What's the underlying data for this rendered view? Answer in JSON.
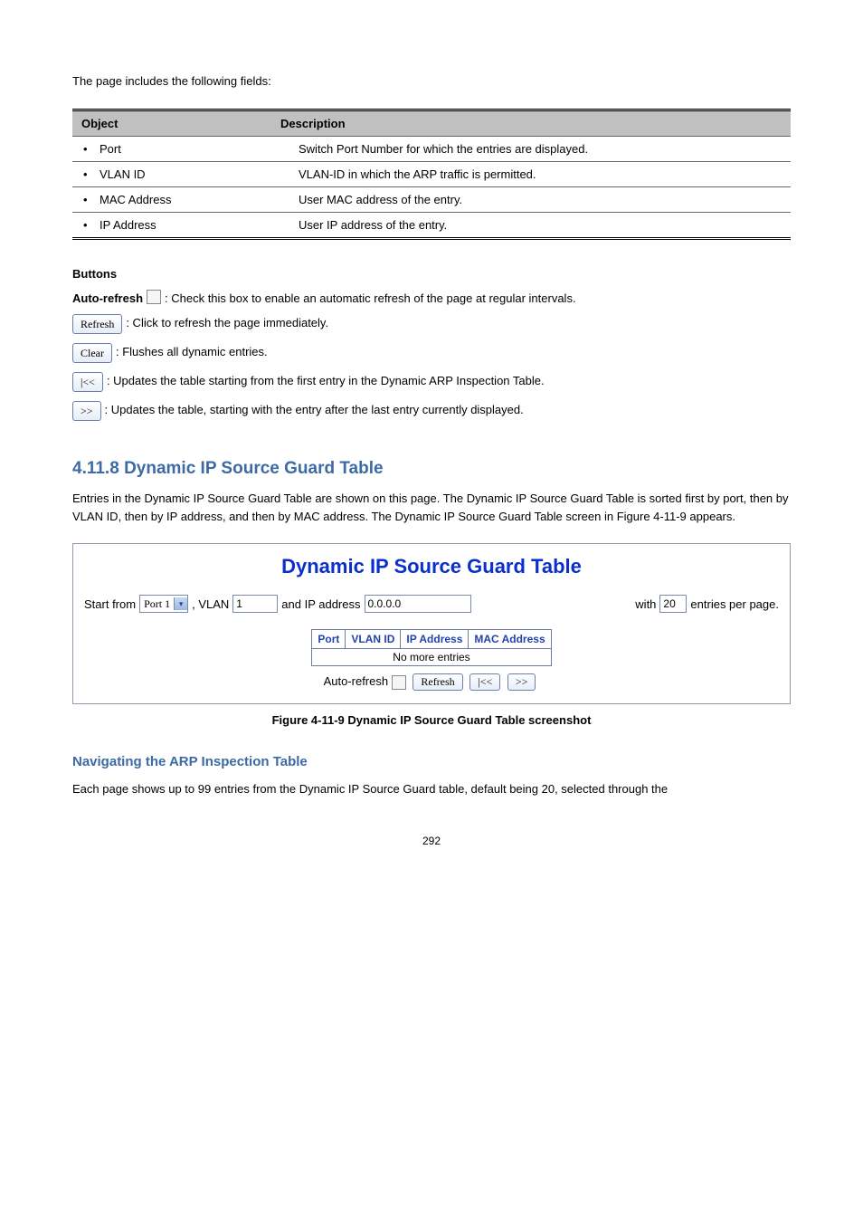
{
  "intro": "The page includes the following fields:",
  "table_headers": {
    "object": "Object",
    "description": "Description"
  },
  "rows": [
    {
      "obj": "Port",
      "desc": "Switch Port Number for which the entries are displayed."
    },
    {
      "obj": "VLAN ID",
      "desc": "VLAN-ID in which the ARP traffic is permitted."
    },
    {
      "obj": "MAC Address",
      "desc": "User MAC address of the entry."
    },
    {
      "obj": "IP Address",
      "desc": "User IP address of the entry."
    }
  ],
  "buttons_heading": "Buttons",
  "controls": {
    "auto_refresh_label": "Auto-refresh",
    "auto_refresh_desc": ": Check this box to enable an automatic refresh of the page at regular intervals.",
    "refresh_label": "Refresh",
    "refresh_desc": ": Click to refresh the page immediately.",
    "clear_label": "Clear",
    "clear_desc": ": Flushes all dynamic entries.",
    "first_label": "|<<",
    "first_desc": ": Updates the table starting from the first entry in the Dynamic ARP Inspection Table.",
    "next_label": ">>",
    "next_desc": ": Updates the table, starting with the entry after the last entry currently displayed."
  },
  "section": {
    "number": "4.11.8",
    "title": "Dynamic IP Source Guard Table",
    "body_1": "Entries in the Dynamic IP Source Guard Table are shown on this page. The Dynamic IP Source Guard Table is sorted first by port, then by VLAN ID, then by IP address, and then by MAC address. The Dynamic IP Source Guard Table screen in ",
    "body_fig_ref": "Figure 4-11-9",
    "body_2": " appears."
  },
  "screenshot": {
    "title": "Dynamic IP Source Guard Table",
    "start_from": "Start from",
    "port_value": "Port 1",
    "vlan_label": ", VLAN",
    "vlan_value": "1",
    "ip_label": "and IP address",
    "ip_value": "0.0.0.0",
    "with_label": "with",
    "with_value": "20",
    "entries_label": "entries per page.",
    "col_port": "Port",
    "col_vlan": "VLAN ID",
    "col_ip": "IP Address",
    "col_mac": "MAC Address",
    "no_more": "No more entries",
    "auto_refresh": "Auto-refresh",
    "btn_refresh": "Refresh",
    "btn_first": "|<<",
    "btn_next": ">>"
  },
  "figure_caption": "Figure 4-11-9 Dynamic IP Source Guard Table screenshot",
  "nav_heading": "Navigating the ARP Inspection Table",
  "nav_body": "Each page shows up to 99 entries from the Dynamic IP Source Guard table, default being 20, selected through the",
  "page_number": "292"
}
